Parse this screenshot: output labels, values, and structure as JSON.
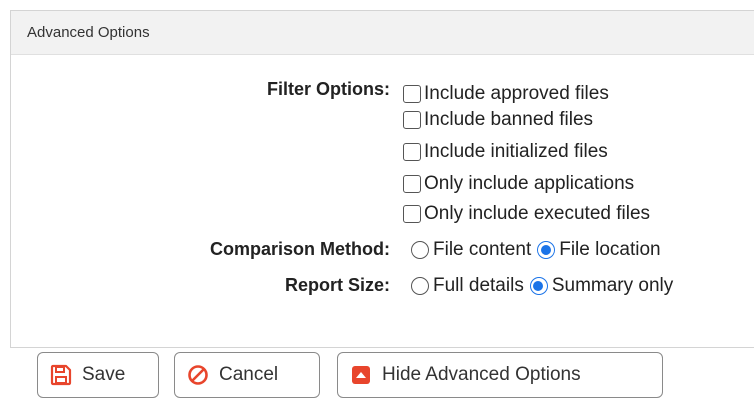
{
  "panel": {
    "title": "Advanced Options"
  },
  "filter": {
    "label": "Filter Options:",
    "options": [
      {
        "label": "Include approved files",
        "checked": false
      },
      {
        "label": "Include banned files",
        "checked": false
      },
      {
        "label": "Include initialized files",
        "checked": false
      },
      {
        "label": "Only include applications",
        "checked": false
      },
      {
        "label": "Only include executed files",
        "checked": false
      }
    ]
  },
  "comparison": {
    "label": "Comparison Method:",
    "options": [
      {
        "label": "File content",
        "selected": false
      },
      {
        "label": "File location",
        "selected": true
      }
    ]
  },
  "report_size": {
    "label": "Report Size:",
    "options": [
      {
        "label": "Full details",
        "selected": false
      },
      {
        "label": "Summary only",
        "selected": true
      }
    ]
  },
  "buttons": {
    "save": {
      "label": "Save",
      "icon": "save-icon"
    },
    "cancel": {
      "label": "Cancel",
      "icon": "cancel-icon"
    },
    "hide_advanced": {
      "label": "Hide Advanced Options",
      "icon": "collapse-up-icon"
    }
  },
  "colors": {
    "accent": "#e8452c",
    "radio_selected": "#1a73e8",
    "header_bg": "#f2f2f2"
  }
}
